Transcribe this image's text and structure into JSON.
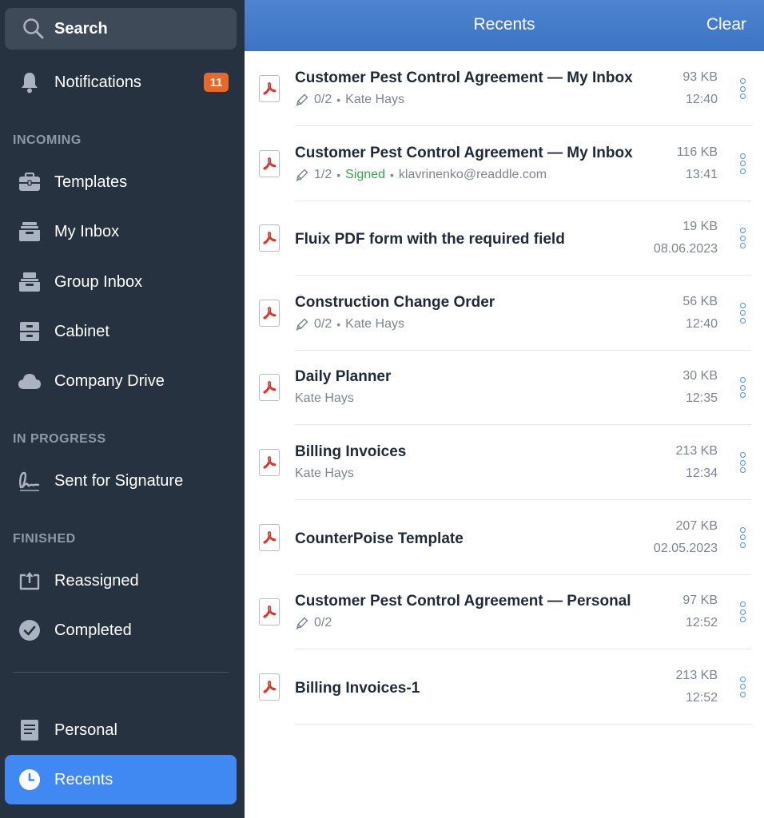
{
  "sidebar": {
    "search_label": "Search",
    "notifications_label": "Notifications",
    "notifications_count": "11",
    "sections": {
      "incoming": "INCOMING",
      "in_progress": "IN PROGRESS",
      "finished": "FINISHED"
    },
    "items": {
      "templates": "Templates",
      "my_inbox": "My Inbox",
      "group_inbox": "Group Inbox",
      "cabinet": "Cabinet",
      "company_drive": "Company Drive",
      "sent_for_signature": "Sent for Signature",
      "reassigned": "Reassigned",
      "completed": "Completed",
      "personal": "Personal",
      "recents": "Recents"
    },
    "active_item": "recents"
  },
  "header": {
    "title": "Recents",
    "clear_label": "Clear"
  },
  "colors": {
    "sidebar_bg": "#263240",
    "accent": "#4089f2",
    "badge": "#e8682a",
    "signed": "#3aa14b",
    "pdf_icon": "#d9372e"
  },
  "icons": {
    "search": "search-icon",
    "notifications": "bell-icon",
    "templates": "briefcase-icon",
    "my_inbox": "inbox-tray-icon",
    "group_inbox": "group-inbox-icon",
    "cabinet": "cabinet-icon",
    "company_drive": "cloud-icon",
    "sent_for_signature": "signature-icon",
    "reassigned": "reassign-icon",
    "completed": "checkmark-circle-icon",
    "personal": "document-icon",
    "recents": "clock-icon",
    "file": "pdf-icon",
    "more": "more-dots-icon"
  },
  "files": [
    {
      "title": "Customer Pest Control Agreement — My Inbox",
      "progress": "0/2",
      "status": "",
      "owner": "Kate Hays",
      "size": "93 KB",
      "date": "12:40"
    },
    {
      "title": "Customer Pest Control Agreement — My Inbox",
      "progress": "1/2",
      "status": "Signed",
      "owner": "klavrinenko@readdle.com",
      "size": "116 KB",
      "date": "13:41"
    },
    {
      "title": "Fluix PDF form with the required field",
      "progress": "",
      "status": "",
      "owner": "",
      "size": "19 KB",
      "date": "08.06.2023"
    },
    {
      "title": "Construction Change Order",
      "progress": "0/2",
      "status": "",
      "owner": "Kate Hays",
      "size": "56 KB",
      "date": "12:40"
    },
    {
      "title": "Daily Planner",
      "progress": "",
      "status": "",
      "owner": "Kate Hays",
      "size": "30 KB",
      "date": "12:35"
    },
    {
      "title": "Billing Invoices",
      "progress": "",
      "status": "",
      "owner": "Kate Hays",
      "size": "213 KB",
      "date": "12:34"
    },
    {
      "title": "CounterPoise Template",
      "progress": "",
      "status": "",
      "owner": "",
      "size": "207 KB",
      "date": "02.05.2023"
    },
    {
      "title": "Customer Pest Control Agreement — Personal",
      "progress": "0/2",
      "status": "",
      "owner": "",
      "size": "97 KB",
      "date": "12:52"
    },
    {
      "title": "Billing Invoices-1",
      "progress": "",
      "status": "",
      "owner": "",
      "size": "213 KB",
      "date": "12:52"
    }
  ]
}
